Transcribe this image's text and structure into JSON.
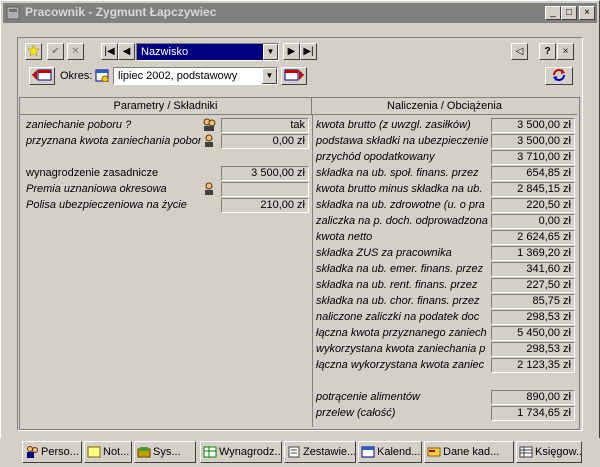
{
  "window": {
    "title": "Pracownik - Zygmunt Łapczywiec",
    "btn_min": "_",
    "btn_max": "□",
    "btn_close": "×"
  },
  "toolbar": {
    "nav_field_value": "Nazwisko",
    "okres_label": "Okres:",
    "okres_value": "lipiec 2002, podstawowy",
    "help_label": "?",
    "close_label": "×"
  },
  "left_header": "Parametry / Składniki",
  "right_header": "Naliczenia / Obciążenia",
  "left_rows": [
    {
      "label": "zaniechanie poboru ?",
      "value": "tak"
    },
    {
      "label": "przyznana kwota zaniechania poboru",
      "value": "0,00 zł"
    },
    {
      "label": "wynagrodzenie zasadnicze",
      "value": "3 500,00 zł"
    },
    {
      "label": "Premia uznaniowa okresowa",
      "value": ""
    },
    {
      "label": "Polisa ubezpieczeniowa na życie",
      "value": "210,00 zł"
    }
  ],
  "right_rows": [
    {
      "label": "kwota brutto (z uwzgl. zasiłków)",
      "value": "3 500,00 zł"
    },
    {
      "label": "podstawa składki na ubezpieczenie",
      "value": "3 500,00 zł"
    },
    {
      "label": "przychód opodatkowany",
      "value": "3 710,00 zł"
    },
    {
      "label": "składka na ub. społ. finans. przez",
      "value": "654,85 zł"
    },
    {
      "label": "kwota brutto minus składka na ub.",
      "value": "2 845,15 zł"
    },
    {
      "label": "składka na ub. zdrowotne (u. o pra",
      "value": "220,50 zł"
    },
    {
      "label": "zaliczka na p. doch. odprowadzona",
      "value": "0,00 zł"
    },
    {
      "label": "kwota netto",
      "value": "2 624,65 zł"
    },
    {
      "label": "składka ZUS za pracownika",
      "value": "1 369,20 zł"
    },
    {
      "label": "składka na ub. emer. finans. przez",
      "value": "341,60 zł"
    },
    {
      "label": "składka na ub. rent. finans. przez",
      "value": "227,50 zł"
    },
    {
      "label": "składka na ub. chor. finans. przez",
      "value": "85,75 zł"
    },
    {
      "label": "naliczone zaliczki na podatek doc",
      "value": "298,53 zł"
    },
    {
      "label": "łączna kwota przyznanego zaniech",
      "value": "5 450,00 zł"
    },
    {
      "label": "wykorzystana kwota zaniechania p",
      "value": "298,53 zł"
    },
    {
      "label": "łączna wykorzystana kwota zaniec",
      "value": "2 123,35 zł"
    },
    {
      "label": "potrącenie alimentów",
      "value": "890,00 zł"
    },
    {
      "label": "przelew (całość)",
      "value": "1 734,65 zł"
    }
  ],
  "taskbar": [
    {
      "label": "Perso...",
      "icon": "people-icon"
    },
    {
      "label": "Not...",
      "icon": "note-icon"
    },
    {
      "label": "Sys...",
      "icon": "system-icon"
    },
    {
      "label": "Wynagrodz...",
      "icon": "spreadsheet-icon"
    },
    {
      "label": "Zestawie...",
      "icon": "report-icon"
    },
    {
      "label": "Kalend...",
      "icon": "calendar-icon"
    },
    {
      "label": "Dane kad...",
      "icon": "card-icon"
    },
    {
      "label": "Księgow...",
      "icon": "ledger-icon"
    }
  ]
}
